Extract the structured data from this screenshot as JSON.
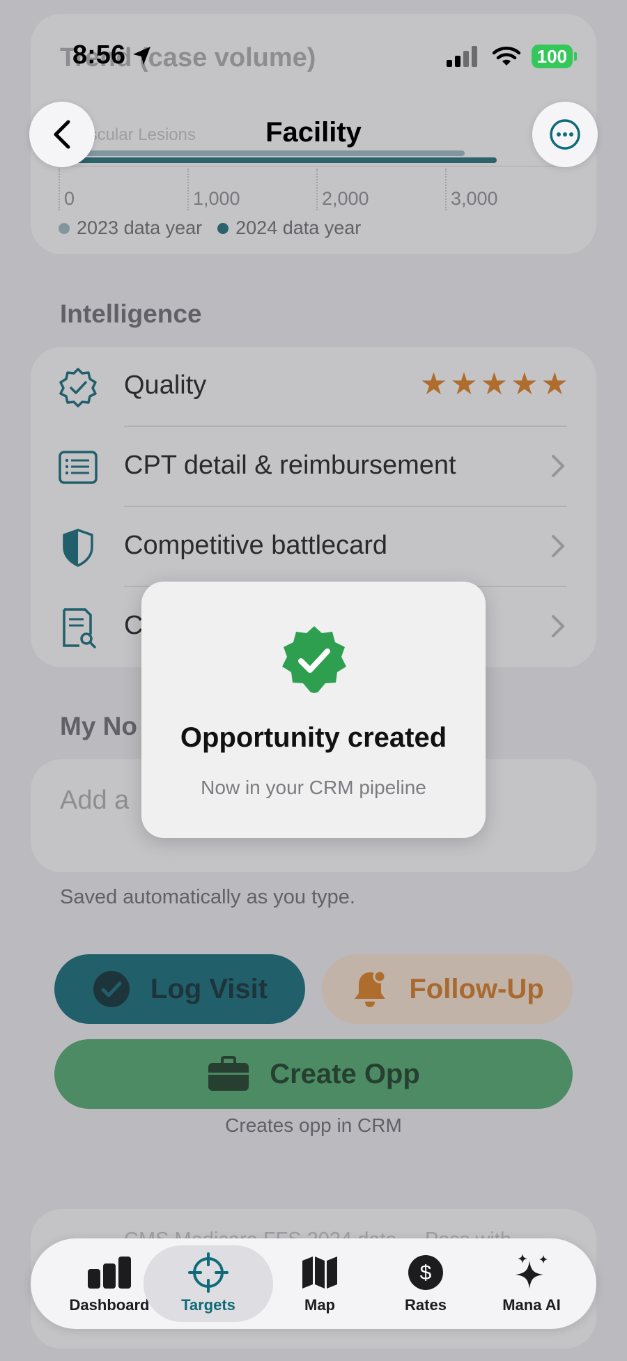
{
  "status_bar": {
    "time": "8:56",
    "battery": "100"
  },
  "nav": {
    "title": "Facility"
  },
  "chart_card": {
    "title": "Trend (case volume)",
    "sublabel": "Vascular Lesions",
    "legend": [
      {
        "label": "2023 data year",
        "color": "#9cbcc2"
      },
      {
        "label": "2024 data year",
        "color": "#1e6f78"
      }
    ]
  },
  "chart_data": {
    "type": "bar",
    "categories": [
      "Vascular Lesions"
    ],
    "series": [
      {
        "name": "2023 data year",
        "values": [
          3150
        ]
      },
      {
        "name": "2024 data year",
        "values": [
          3400
        ]
      }
    ],
    "xticks": [
      "0",
      "1,000",
      "2,000",
      "3,000"
    ],
    "xlim": [
      0,
      4000
    ],
    "orientation": "horizontal"
  },
  "intelligence": {
    "label": "Intelligence",
    "rows": [
      {
        "label": "Quality",
        "rating": 5
      },
      {
        "label": "CPT detail & reimbursement"
      },
      {
        "label": "Competitive battlecard"
      },
      {
        "label": "C"
      }
    ]
  },
  "notes": {
    "label": "My No",
    "placeholder": "Add a",
    "helper": "Saved automatically as you type."
  },
  "actions": {
    "log_visit": "Log Visit",
    "follow_up": "Follow-Up",
    "create_opp": "Create Opp",
    "create_opp_caption": "Creates opp in CRM"
  },
  "footer": {
    "text": "CMS Medicare FFS 2024 data ... Poss with"
  },
  "toast": {
    "title": "Opportunity created",
    "subtitle": "Now in your CRM pipeline"
  },
  "tabbar": {
    "items": [
      {
        "label": "Dashboard",
        "icon": "bar-chart-icon"
      },
      {
        "label": "Targets",
        "icon": "crosshair-icon",
        "active": true
      },
      {
        "label": "Map",
        "icon": "map-icon"
      },
      {
        "label": "Rates",
        "icon": "dollar-circle-icon"
      },
      {
        "label": "Mana AI",
        "icon": "sparkles-icon"
      }
    ]
  },
  "colors": {
    "accent_teal": "#0f6b78",
    "accent_orange": "#e07f1c",
    "accent_green": "#4eac6c",
    "badge_green": "#2e9e4f",
    "battery_green": "#34c759"
  }
}
